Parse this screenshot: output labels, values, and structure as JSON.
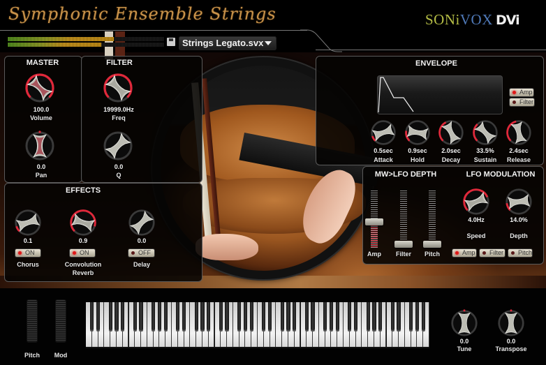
{
  "header": {
    "title": "Symphonic Ensemble Strings",
    "brand_soni": "SONi",
    "brand_vox": "VOX",
    "brand_dvi": "DVi"
  },
  "meters": {
    "left_level_pct": 68,
    "right_level_pct": 60
  },
  "preset": {
    "icon": "save-icon",
    "name": "Strings Legato.svx",
    "dropdown_icon": "chevron-down-icon"
  },
  "master": {
    "title": "MASTER",
    "volume": {
      "label": "Volume",
      "value": "100.0",
      "pct": 100
    },
    "pan": {
      "label": "Pan",
      "value": "0.0",
      "pct": 50
    }
  },
  "filter": {
    "title": "FILTER",
    "freq": {
      "label": "Freq",
      "value": "19999.0Hz",
      "pct": 100
    },
    "q": {
      "label": "Q",
      "value": "0.0",
      "pct": 0
    }
  },
  "effects": {
    "title": "EFFECTS",
    "items": [
      {
        "label": "Chorus",
        "label2": "",
        "value": "0.1",
        "pct": 10,
        "toggle": "ON",
        "on": true
      },
      {
        "label": "Convolution",
        "label2": "Reverb",
        "value": "0.9",
        "pct": 90,
        "toggle": "ON",
        "on": true
      },
      {
        "label": "Delay",
        "label2": "",
        "value": "0.0",
        "pct": 0,
        "toggle": "OFF",
        "on": false
      }
    ]
  },
  "envelope": {
    "title": "ENVELOPE",
    "targets": [
      {
        "label": "Amp",
        "on": true
      },
      {
        "label": "Filter",
        "on": false
      }
    ],
    "knobs": [
      {
        "label": "Attack",
        "value": "0.5sec",
        "pct": 10
      },
      {
        "label": "Hold",
        "value": "0.9sec",
        "pct": 20
      },
      {
        "label": "Decay",
        "value": "2.0sec",
        "pct": 40
      },
      {
        "label": "Sustain",
        "value": "33.5%",
        "pct": 34
      },
      {
        "label": "Release",
        "value": "2.4sec",
        "pct": 45
      }
    ]
  },
  "mw_lfo_depth": {
    "title": "MW>LFO DEPTH",
    "sliders": [
      {
        "label": "Amp",
        "pct": 45
      },
      {
        "label": "Filter",
        "pct": 0
      },
      {
        "label": "Pitch",
        "pct": 0
      }
    ]
  },
  "lfo_modulation": {
    "title": "LFO MODULATION",
    "speed": {
      "label": "Speed",
      "value": "4.0Hz",
      "pct": 75
    },
    "depth": {
      "label": "Depth",
      "value": "14.0%",
      "pct": 14
    },
    "targets": [
      {
        "label": "Amp",
        "on": true
      },
      {
        "label": "Filter",
        "on": false
      },
      {
        "label": "Pitch",
        "on": false
      }
    ]
  },
  "wheels": {
    "pitch_label": "Pitch",
    "mod_label": "Mod"
  },
  "keyboard": {
    "octaves": 8,
    "first_note": "C"
  },
  "tune": {
    "label": "Tune",
    "value": "0.0",
    "pct": 50
  },
  "transpose": {
    "label": "Transpose",
    "value": "0.0",
    "pct": 50
  },
  "colors": {
    "accent_red": "#e0283a",
    "title_gold": "#c8924a",
    "led_on": "#e01818",
    "led_off": "#5a1a1a"
  }
}
